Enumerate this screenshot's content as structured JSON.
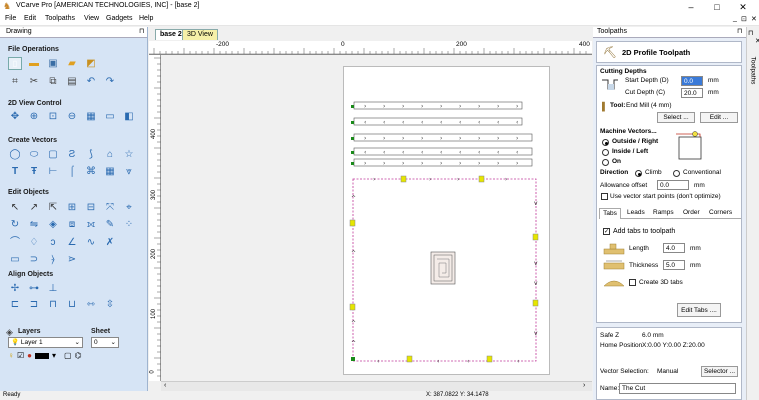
{
  "window": {
    "title": "VCarve Pro [AMERICAN TECHNOLOGIES, INC] - [base 2]",
    "controls": [
      "–",
      "□",
      "✕"
    ],
    "mdi_controls": [
      "_",
      "⊡",
      "✕"
    ]
  },
  "menu": [
    "File",
    "Edit",
    "Toolpaths",
    "View",
    "Gadgets",
    "Help"
  ],
  "left_panel": {
    "title": "Drawing",
    "pin": "⊓",
    "sections": {
      "file_ops": "File Operations",
      "view_control": "2D View Control",
      "create_vectors": "Create Vectors",
      "edit_objects": "Edit Objects",
      "align_objects": "Align Objects"
    },
    "layers": {
      "label": "Layers",
      "sheet_label": "Sheet",
      "layer_value": "Layer 1",
      "sheet_value": "0"
    }
  },
  "doc_tabs": [
    "base 2",
    "3D View"
  ],
  "rulers": {
    "top": [
      "-200",
      "0",
      "200",
      "400"
    ],
    "left": [
      "400",
      "300",
      "200",
      "100",
      "0"
    ]
  },
  "canvas_rows": [
    {
      "arrows": [
        "›",
        "›",
        "›",
        "›",
        "›",
        "›",
        "›",
        "›",
        "›"
      ]
    },
    {
      "arrows": [
        "‹",
        "‹",
        "‹",
        "‹",
        "‹",
        "‹",
        "‹",
        "‹",
        "‹"
      ]
    },
    {
      "arrows": [
        "›",
        "›",
        "›",
        "›",
        "›",
        "›",
        "›",
        "›",
        "›"
      ]
    },
    {
      "arrows": [
        "‹",
        "‹",
        "‹",
        "‹",
        "‹",
        "‹",
        "‹",
        "‹",
        "‹"
      ]
    },
    {
      "arrows": [
        "›",
        "›",
        "›",
        "›",
        "›",
        "›",
        "›",
        "›",
        "›"
      ]
    }
  ],
  "status": {
    "left": "Ready",
    "coords": "X: 387.0822 Y: 34.1478"
  },
  "right_panel": {
    "title": "Toolpaths",
    "pin": "⊓",
    "vertical_tab": "Toolpaths",
    "header": "2D Profile Toolpath",
    "cutting_depths": {
      "heading": "Cutting Depths",
      "start_label": "Start Depth (D)",
      "start_value": "0.0",
      "cut_label": "Cut Depth (C)",
      "cut_value": "20.0",
      "unit": "mm"
    },
    "tool": {
      "label": "Tool:",
      "value": "End Mill (4 mm)",
      "select_btn": "Select ...",
      "edit_btn": "Edit ..."
    },
    "machine_vectors": {
      "heading": "Machine Vectors...",
      "options": [
        "Outside / Right",
        "Inside / Left",
        "On"
      ],
      "selected": 0
    },
    "direction": {
      "label": "Direction",
      "options": [
        "Climb",
        "Conventional"
      ],
      "selected": 0
    },
    "allowance": {
      "label": "Allowance offset",
      "value": "0.0",
      "unit": "mm"
    },
    "vector_start_label": "Use vector start points (don't optimize)",
    "subtabs": [
      "Tabs",
      "Leads",
      "Ramps",
      "Order",
      "Corners"
    ],
    "tabs_section": {
      "add_tabs_label": "Add tabs to toolpath",
      "add_tabs_checked": true,
      "length_label": "Length",
      "length_value": "4.0",
      "thickness_label": "Thickness",
      "thickness_value": "5.0",
      "unit": "mm",
      "create3d_label": "Create 3D tabs",
      "edit_tabs_btn": "Edit Tabs ...."
    },
    "safe_z": {
      "label": "Safe Z",
      "value": "6.0 mm"
    },
    "home_position": {
      "label": "Home Position",
      "value": "X:0.00 Y:0.00 Z:20.00"
    },
    "vector_selection": {
      "label": "Vector Selection:",
      "value": "Manual",
      "button": "Selector ..."
    },
    "name": {
      "label": "Name:",
      "value": "The Cut"
    }
  },
  "colors": {
    "accent": "#3a6ea5",
    "panel_bg": "#d6e4f5",
    "toolpath_magenta": "#c0389a",
    "node_green": "#1a8a1a",
    "tab_yellow": "#e6e600"
  }
}
